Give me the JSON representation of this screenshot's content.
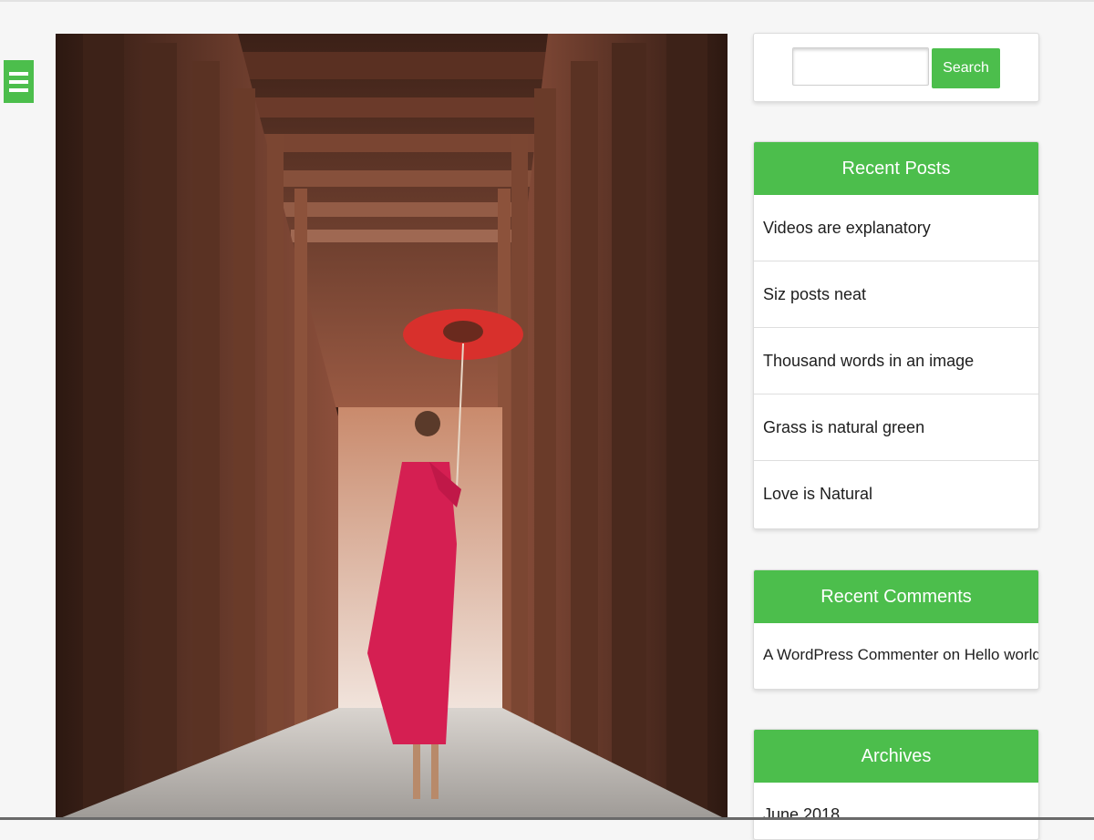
{
  "menu": {
    "icon": "hamburger-menu-icon"
  },
  "hero": {
    "alt": "Monk with red umbrella walking through wooden corridor"
  },
  "search": {
    "input_value": "",
    "placeholder": "",
    "button_label": "Search"
  },
  "recent_posts": {
    "title": "Recent Posts",
    "items": [
      "Videos are explanatory",
      "Siz posts neat",
      "Thousand words in an image",
      "Grass is natural green",
      "Love is Natural"
    ]
  },
  "recent_comments": {
    "title": "Recent Comments",
    "items": [
      "A WordPress Commenter on Hello world!"
    ]
  },
  "archives": {
    "title": "Archives",
    "items": [
      "June 2018"
    ]
  },
  "colors": {
    "accent": "#4cbe4c",
    "background": "#f6f6f6",
    "text": "#1e1e1e"
  }
}
